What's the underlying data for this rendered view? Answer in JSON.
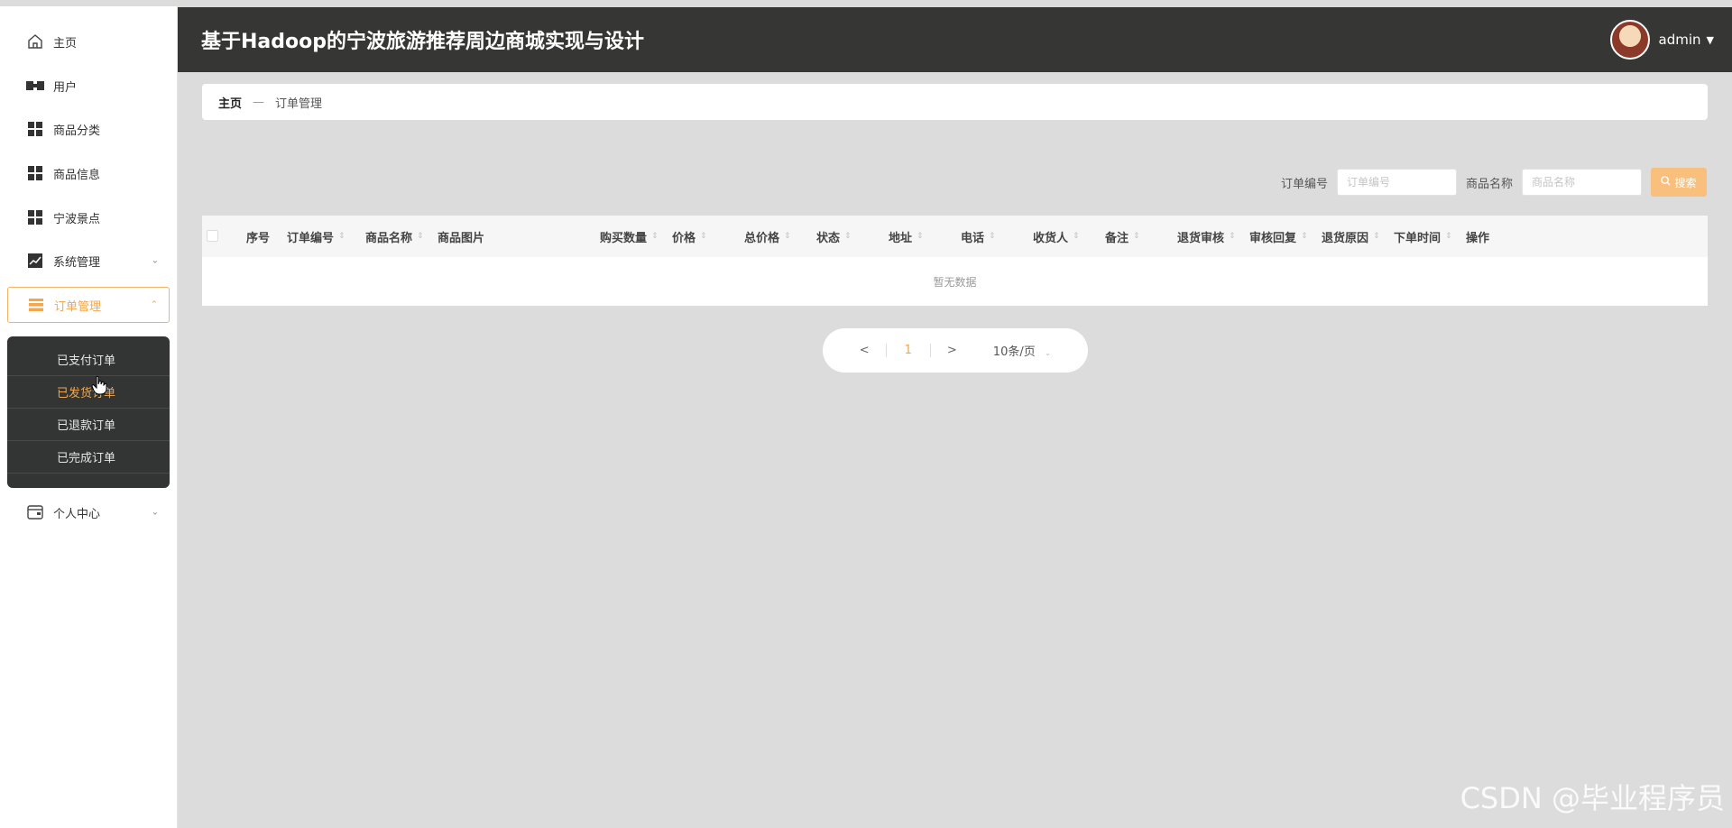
{
  "header": {
    "title": "基于Hadoop的宁波旅游推荐周边商城实现与设计",
    "username": "admin"
  },
  "sidebar": {
    "items": [
      {
        "label": "主页",
        "icon": "home-icon"
      },
      {
        "label": "用户",
        "icon": "users-icon"
      },
      {
        "label": "商品分类",
        "icon": "grid-icon"
      },
      {
        "label": "商品信息",
        "icon": "grid-icon"
      },
      {
        "label": "宁波景点",
        "icon": "grid-icon"
      },
      {
        "label": "系统管理",
        "icon": "chart-icon"
      },
      {
        "label": "订单管理",
        "icon": "list-icon"
      },
      {
        "label": "个人中心",
        "icon": "wallet-icon"
      }
    ],
    "submenu": [
      {
        "label": "已支付订单"
      },
      {
        "label": "已发货订单"
      },
      {
        "label": "已退款订单"
      },
      {
        "label": "已完成订单"
      }
    ]
  },
  "breadcrumb": {
    "home": "主页",
    "separator": "—",
    "current": "订单管理"
  },
  "search": {
    "order_label": "订单编号",
    "order_placeholder": "订单编号",
    "product_label": "商品名称",
    "product_placeholder": "商品名称",
    "button_label": "搜索"
  },
  "table": {
    "columns": [
      "序号",
      "订单编号",
      "商品名称",
      "商品图片",
      "购买数量",
      "价格",
      "总价格",
      "状态",
      "地址",
      "电话",
      "收货人",
      "备注",
      "退货审核",
      "审核回复",
      "退货原因",
      "下单时间",
      "操作"
    ],
    "empty_text": "暂无数据"
  },
  "pagination": {
    "prev": "<",
    "page": "1",
    "next": ">",
    "page_size": "10条/页"
  },
  "watermark": "CSDN @毕业程序员",
  "colors": {
    "accent": "#f4a64a",
    "header_bg": "#363735",
    "submenu_bg": "#333534"
  }
}
